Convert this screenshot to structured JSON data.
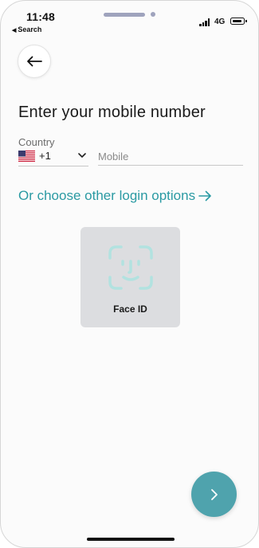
{
  "status_bar": {
    "time": "11:48",
    "back_app": "Search",
    "network": "4G"
  },
  "login": {
    "title": "Enter your mobile number",
    "country_label": "Country",
    "dial_code": "+1",
    "mobile_placeholder": "Mobile",
    "other_options": "Or choose other login options"
  },
  "face_id": {
    "label": "Face ID"
  },
  "colors": {
    "accent": "#2a9aa3",
    "next_button": "#4fa3ad",
    "card_bg": "#dcdde0"
  },
  "icons": {
    "back": "arrow-left-icon",
    "flag": "us-flag-icon",
    "dropdown": "chevron-down-icon",
    "link_arrow": "arrow-right-icon",
    "face_id": "face-id-icon",
    "next": "chevron-right-icon"
  }
}
